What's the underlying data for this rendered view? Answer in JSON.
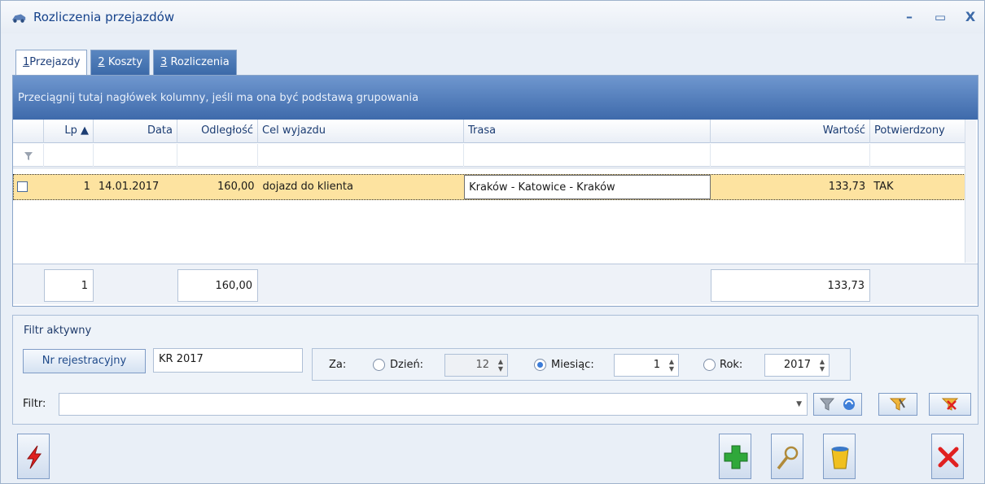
{
  "window": {
    "title": "Rozliczenia przejazdów",
    "minimize": "–",
    "maximize": "▭",
    "close": "X"
  },
  "tabs": [
    {
      "num": "1",
      "label": "Przejazdy"
    },
    {
      "num": "2",
      "label": "Koszty"
    },
    {
      "num": "3",
      "label": "Rozliczenia"
    }
  ],
  "grid": {
    "group_hint": "Przeciągnij tutaj nagłówek kolumny, jeśli ma ona być podstawą grupowania",
    "columns": [
      "",
      "Lp ▲",
      "Data",
      "Odległość",
      "Cel wyjazdu",
      "Trasa",
      "Wartość",
      "Potwierdzony"
    ],
    "rows": [
      {
        "lp": "1",
        "data": "14.01.2017",
        "odleglosc": "160,00",
        "cel": "dojazd do klienta",
        "trasa": "Kraków - Katowice - Kraków",
        "wartosc": "133,73",
        "potwierdzony": "TAK"
      }
    ],
    "summary": {
      "lp": "1",
      "odleglosc": "160,00",
      "wartosc": "133,73"
    }
  },
  "filter": {
    "title": "Filtr aktywny",
    "nr_rej_button": "Nr rejestracyjny",
    "nr_rej_value": "KR 2017",
    "za_label": "Za:",
    "dzien_label": "Dzień:",
    "dzien_value": "12",
    "miesiac_label": "Miesiąc:",
    "miesiac_value": "1",
    "rok_label": "Rok:",
    "rok_value": "2017",
    "filtr_label": "Filtr:",
    "filtr_value": "",
    "selected_period": "miesiac"
  },
  "icons": {
    "funnel": "funnel-icon",
    "clear_filter": "clear-filter-icon",
    "add": "plus-icon",
    "edit": "magnifier-icon",
    "delete": "trash-icon",
    "cancel": "close-icon",
    "lightning": "lightning-icon"
  },
  "colors": {
    "accent": "#3e6aab",
    "selected_row": "#fde3a0",
    "add_green": "#2fa83a",
    "cancel_red": "#e02020"
  }
}
